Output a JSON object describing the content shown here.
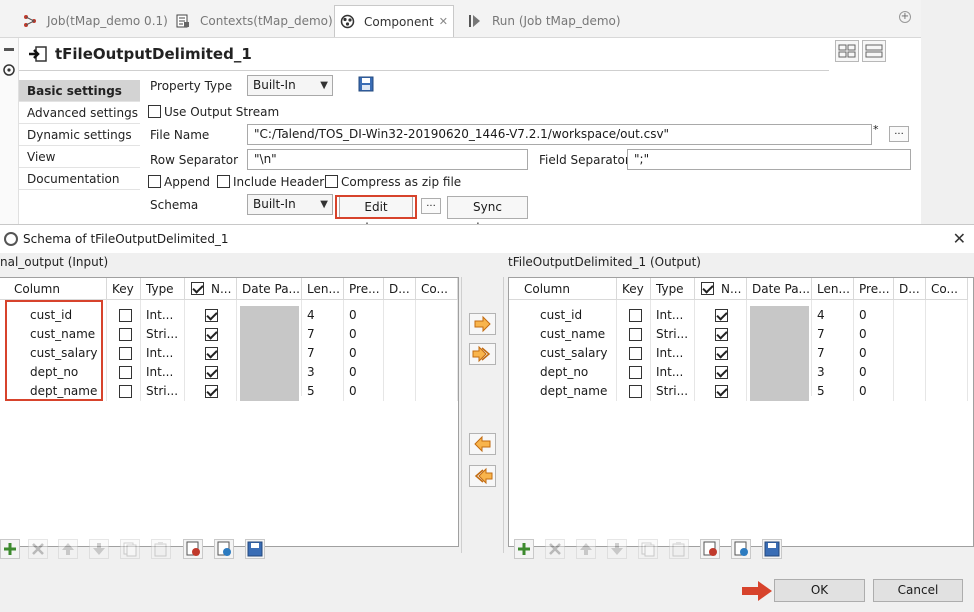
{
  "tabs": [
    {
      "label": "Job(tMap_demo 0.1)",
      "icon": "job-icon"
    },
    {
      "label": "Contexts(tMap_demo)",
      "icon": "contexts-icon"
    },
    {
      "label": "Component",
      "icon": "component-icon",
      "active": true
    },
    {
      "label": "Run (Job tMap_demo)",
      "icon": "run-icon"
    }
  ],
  "component": {
    "title": "tFileOutputDelimited_1"
  },
  "sidenav": [
    "Basic settings",
    "Advanced settings",
    "Dynamic settings",
    "View",
    "Documentation"
  ],
  "settings": {
    "property_type_label": "Property Type",
    "property_type_value": "Built-In",
    "use_output_stream": "Use Output Stream",
    "file_name_label": "File Name",
    "file_name_value": "\"C:/Talend/TOS_DI-Win32-20190620_1446-V7.2.1/workspace/out.csv\"",
    "file_name_asterisk": "*",
    "row_sep_label": "Row Separator",
    "row_sep_value": "\"\\n\"",
    "field_sep_label": "Field Separator",
    "field_sep_value": "\";\"",
    "append": "Append",
    "include_header": "Include Header",
    "compress": "Compress as zip file",
    "schema_label": "Schema",
    "schema_value": "Built-In",
    "edit_schema": "Edit schema",
    "dots": "...",
    "sync_columns": "Sync columns"
  },
  "dialog": {
    "title": "Schema of tFileOutputDelimited_1",
    "close": "✕",
    "left_title": "nal_output (Input)",
    "right_title": "tFileOutputDelimited_1 (Output)",
    "headers": [
      "Column",
      "Key",
      "Type",
      "N...",
      "Date Pa...",
      "Len...",
      "Pre...",
      "D...",
      "Co..."
    ],
    "rows": [
      {
        "column": "cust_id",
        "type": "Int...",
        "nullable": true,
        "length": "4",
        "precision": "0"
      },
      {
        "column": "cust_name",
        "type": "Stri...",
        "nullable": true,
        "length": "7",
        "precision": "0"
      },
      {
        "column": "cust_salary",
        "type": "Int...",
        "nullable": true,
        "length": "7",
        "precision": "0"
      },
      {
        "column": "dept_no",
        "type": "Int...",
        "nullable": true,
        "length": "3",
        "precision": "0"
      },
      {
        "column": "dept_name",
        "type": "Stri...",
        "nullable": true,
        "length": "5",
        "precision": "0"
      }
    ],
    "ok": "OK",
    "cancel": "Cancel"
  },
  "colors": {
    "highlight_red": "#d7432c",
    "arrow_orange": "#f08a24",
    "greyed_cell": "#c7c7c7"
  }
}
